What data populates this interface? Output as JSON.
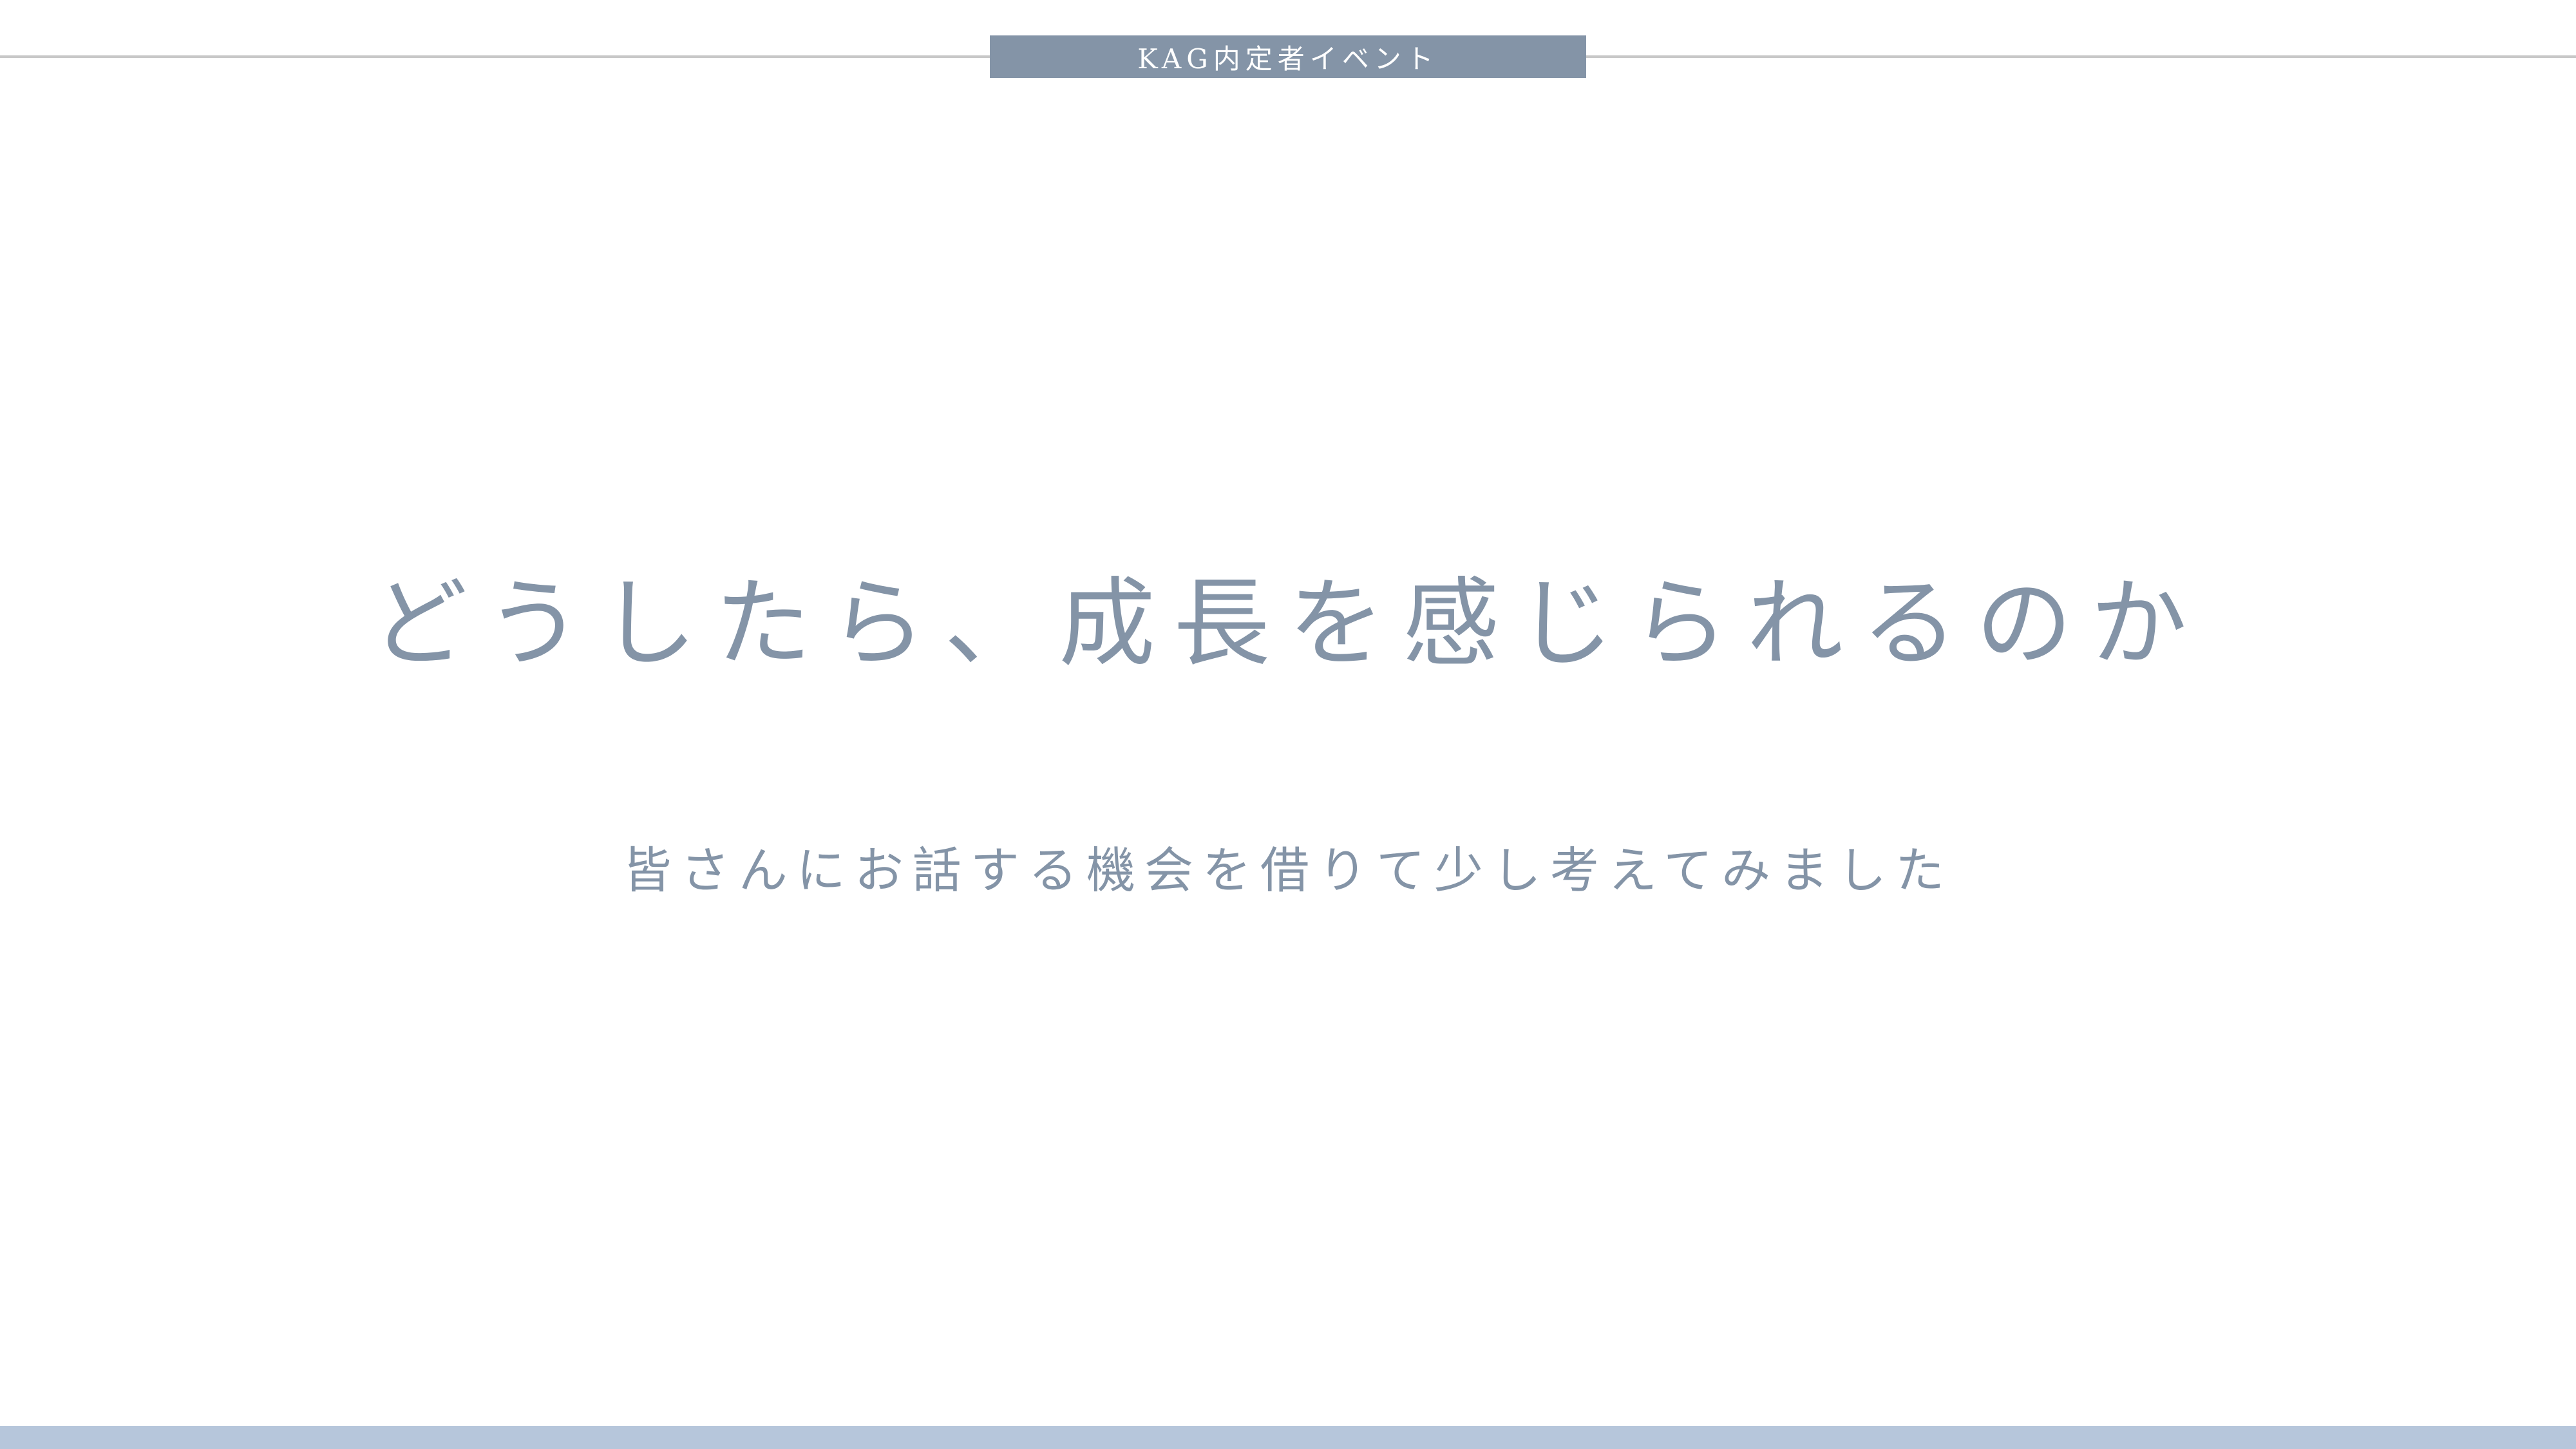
{
  "header": {
    "label": "KAG内定者イベント"
  },
  "slide": {
    "title": "どうしたら、成長を感じられるのか",
    "subtitle": "皆さんにお話する機会を借りて少し考えてみました"
  },
  "colors": {
    "accent": "#8494a7",
    "rule": "#c8c8c8",
    "footer_bar": "#b6c6db",
    "background": "#ffffff"
  }
}
